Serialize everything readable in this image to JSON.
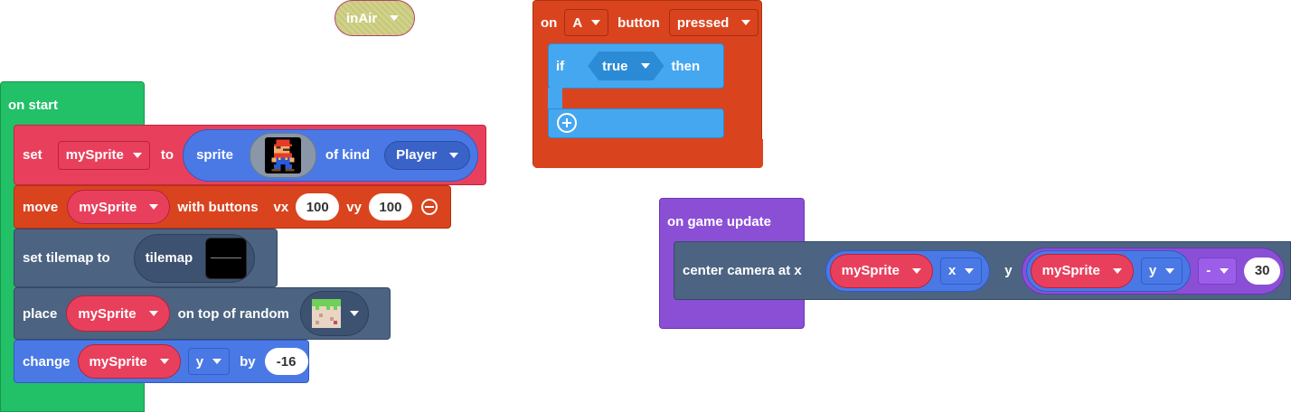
{
  "variable_block": {
    "label": "inAir"
  },
  "on_start": {
    "label": "on start",
    "set": {
      "set_word": "set",
      "variable": "mySprite",
      "to_word": "to",
      "sprite_word": "sprite",
      "of_kind_word": "of kind",
      "kind": "Player"
    },
    "move": {
      "move_word": "move",
      "variable": "mySprite",
      "with_buttons_word": "with buttons",
      "vx_label": "vx",
      "vx_value": "100",
      "vy_label": "vy",
      "vy_value": "100"
    },
    "tilemap": {
      "label": "set tilemap to",
      "tilemap_word": "tilemap"
    },
    "place": {
      "place_word": "place",
      "variable": "mySprite",
      "on_top_word": "on top of random"
    },
    "change": {
      "change_word": "change",
      "variable": "mySprite",
      "property": "y",
      "by_word": "by",
      "value": "-16"
    }
  },
  "on_button": {
    "on_word": "on",
    "button_name": "A",
    "button_word": "button",
    "event": "pressed",
    "if_block": {
      "if_word": "if",
      "condition": "true",
      "then_word": "then"
    }
  },
  "on_game_update": {
    "label": "on game update",
    "center": {
      "label": "center camera at x",
      "x_variable": "mySprite",
      "x_property": "x",
      "y_label": "y",
      "y_variable": "mySprite",
      "y_property": "y",
      "operator": "-",
      "offset": "30"
    }
  }
}
